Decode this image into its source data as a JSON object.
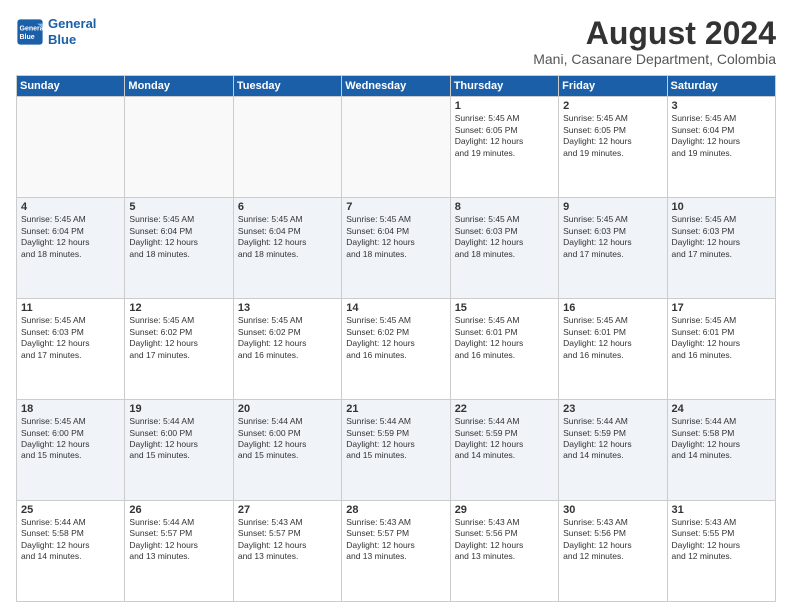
{
  "header": {
    "logo_line1": "General",
    "logo_line2": "Blue",
    "title": "August 2024",
    "subtitle": "Mani, Casanare Department, Colombia"
  },
  "weekdays": [
    "Sunday",
    "Monday",
    "Tuesday",
    "Wednesday",
    "Thursday",
    "Friday",
    "Saturday"
  ],
  "weeks": [
    [
      {
        "day": "",
        "info": ""
      },
      {
        "day": "",
        "info": ""
      },
      {
        "day": "",
        "info": ""
      },
      {
        "day": "",
        "info": ""
      },
      {
        "day": "1",
        "info": "Sunrise: 5:45 AM\nSunset: 6:05 PM\nDaylight: 12 hours\nand 19 minutes."
      },
      {
        "day": "2",
        "info": "Sunrise: 5:45 AM\nSunset: 6:05 PM\nDaylight: 12 hours\nand 19 minutes."
      },
      {
        "day": "3",
        "info": "Sunrise: 5:45 AM\nSunset: 6:04 PM\nDaylight: 12 hours\nand 19 minutes."
      }
    ],
    [
      {
        "day": "4",
        "info": "Sunrise: 5:45 AM\nSunset: 6:04 PM\nDaylight: 12 hours\nand 18 minutes."
      },
      {
        "day": "5",
        "info": "Sunrise: 5:45 AM\nSunset: 6:04 PM\nDaylight: 12 hours\nand 18 minutes."
      },
      {
        "day": "6",
        "info": "Sunrise: 5:45 AM\nSunset: 6:04 PM\nDaylight: 12 hours\nand 18 minutes."
      },
      {
        "day": "7",
        "info": "Sunrise: 5:45 AM\nSunset: 6:04 PM\nDaylight: 12 hours\nand 18 minutes."
      },
      {
        "day": "8",
        "info": "Sunrise: 5:45 AM\nSunset: 6:03 PM\nDaylight: 12 hours\nand 18 minutes."
      },
      {
        "day": "9",
        "info": "Sunrise: 5:45 AM\nSunset: 6:03 PM\nDaylight: 12 hours\nand 17 minutes."
      },
      {
        "day": "10",
        "info": "Sunrise: 5:45 AM\nSunset: 6:03 PM\nDaylight: 12 hours\nand 17 minutes."
      }
    ],
    [
      {
        "day": "11",
        "info": "Sunrise: 5:45 AM\nSunset: 6:03 PM\nDaylight: 12 hours\nand 17 minutes."
      },
      {
        "day": "12",
        "info": "Sunrise: 5:45 AM\nSunset: 6:02 PM\nDaylight: 12 hours\nand 17 minutes."
      },
      {
        "day": "13",
        "info": "Sunrise: 5:45 AM\nSunset: 6:02 PM\nDaylight: 12 hours\nand 16 minutes."
      },
      {
        "day": "14",
        "info": "Sunrise: 5:45 AM\nSunset: 6:02 PM\nDaylight: 12 hours\nand 16 minutes."
      },
      {
        "day": "15",
        "info": "Sunrise: 5:45 AM\nSunset: 6:01 PM\nDaylight: 12 hours\nand 16 minutes."
      },
      {
        "day": "16",
        "info": "Sunrise: 5:45 AM\nSunset: 6:01 PM\nDaylight: 12 hours\nand 16 minutes."
      },
      {
        "day": "17",
        "info": "Sunrise: 5:45 AM\nSunset: 6:01 PM\nDaylight: 12 hours\nand 16 minutes."
      }
    ],
    [
      {
        "day": "18",
        "info": "Sunrise: 5:45 AM\nSunset: 6:00 PM\nDaylight: 12 hours\nand 15 minutes."
      },
      {
        "day": "19",
        "info": "Sunrise: 5:44 AM\nSunset: 6:00 PM\nDaylight: 12 hours\nand 15 minutes."
      },
      {
        "day": "20",
        "info": "Sunrise: 5:44 AM\nSunset: 6:00 PM\nDaylight: 12 hours\nand 15 minutes."
      },
      {
        "day": "21",
        "info": "Sunrise: 5:44 AM\nSunset: 5:59 PM\nDaylight: 12 hours\nand 15 minutes."
      },
      {
        "day": "22",
        "info": "Sunrise: 5:44 AM\nSunset: 5:59 PM\nDaylight: 12 hours\nand 14 minutes."
      },
      {
        "day": "23",
        "info": "Sunrise: 5:44 AM\nSunset: 5:59 PM\nDaylight: 12 hours\nand 14 minutes."
      },
      {
        "day": "24",
        "info": "Sunrise: 5:44 AM\nSunset: 5:58 PM\nDaylight: 12 hours\nand 14 minutes."
      }
    ],
    [
      {
        "day": "25",
        "info": "Sunrise: 5:44 AM\nSunset: 5:58 PM\nDaylight: 12 hours\nand 14 minutes."
      },
      {
        "day": "26",
        "info": "Sunrise: 5:44 AM\nSunset: 5:57 PM\nDaylight: 12 hours\nand 13 minutes."
      },
      {
        "day": "27",
        "info": "Sunrise: 5:43 AM\nSunset: 5:57 PM\nDaylight: 12 hours\nand 13 minutes."
      },
      {
        "day": "28",
        "info": "Sunrise: 5:43 AM\nSunset: 5:57 PM\nDaylight: 12 hours\nand 13 minutes."
      },
      {
        "day": "29",
        "info": "Sunrise: 5:43 AM\nSunset: 5:56 PM\nDaylight: 12 hours\nand 13 minutes."
      },
      {
        "day": "30",
        "info": "Sunrise: 5:43 AM\nSunset: 5:56 PM\nDaylight: 12 hours\nand 12 minutes."
      },
      {
        "day": "31",
        "info": "Sunrise: 5:43 AM\nSunset: 5:55 PM\nDaylight: 12 hours\nand 12 minutes."
      }
    ]
  ]
}
